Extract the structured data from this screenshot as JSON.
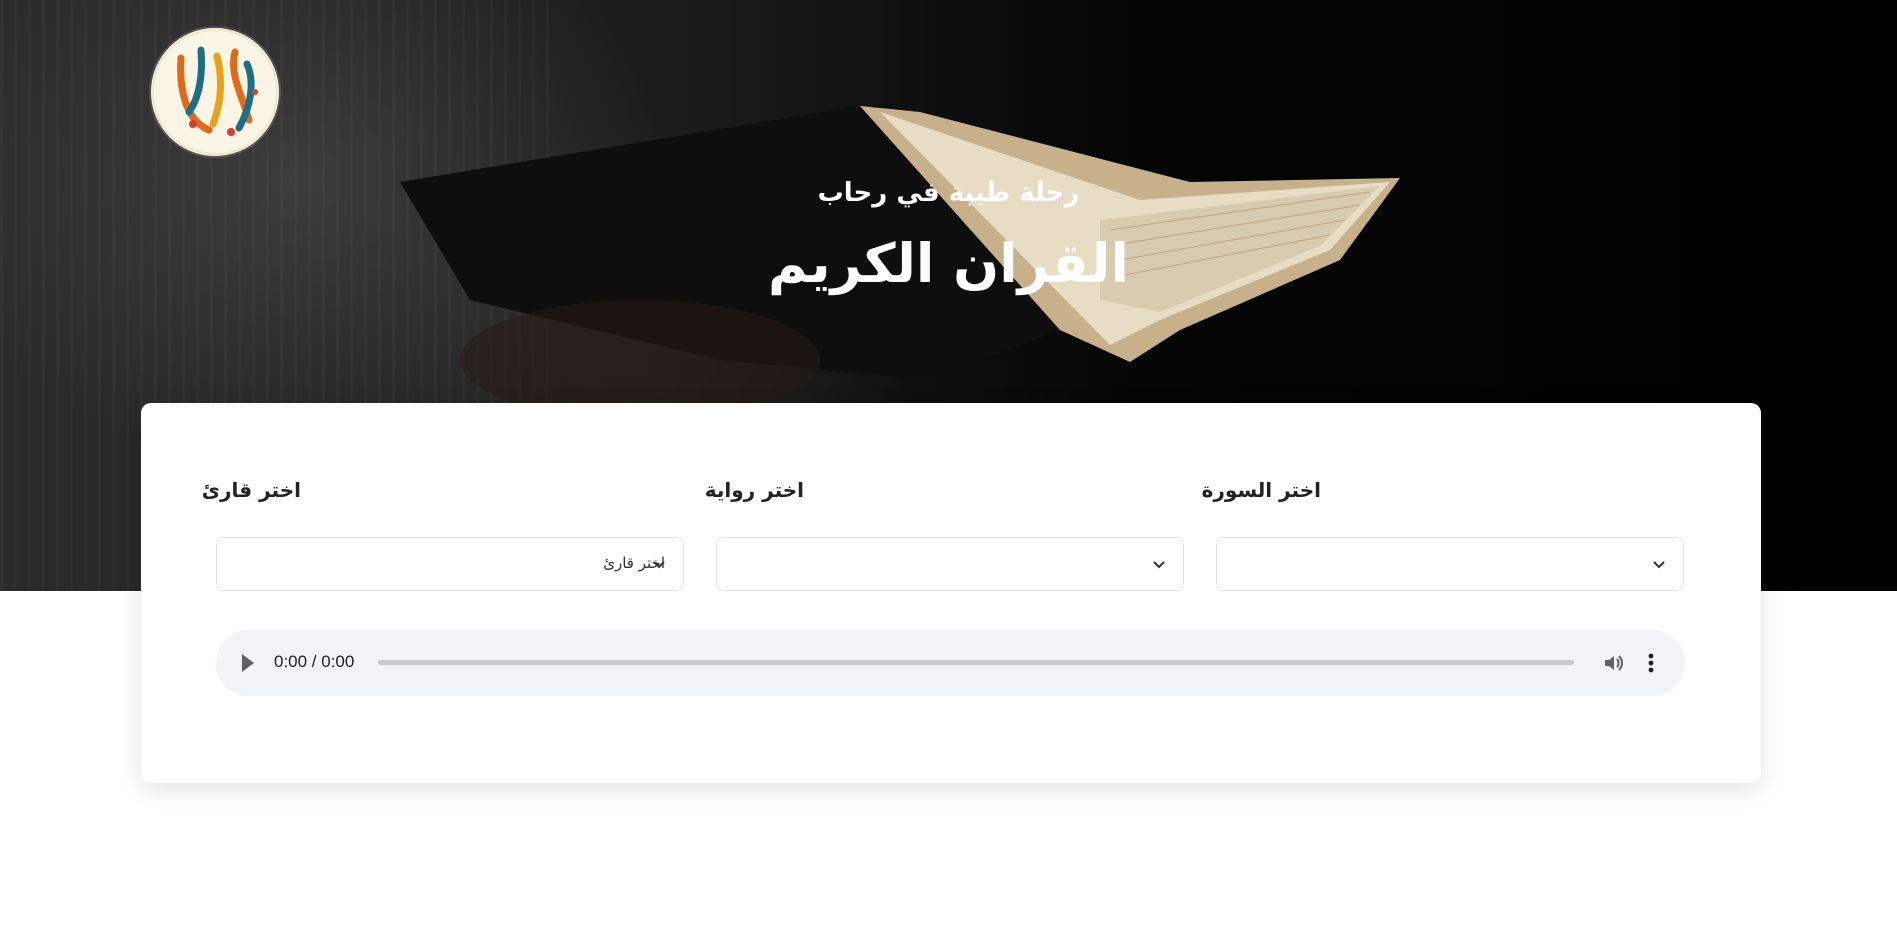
{
  "hero": {
    "subtitle": "رحلة طيبة في رحاب",
    "title": "القران الكريم"
  },
  "selectors": {
    "reciter": {
      "label": "اختر قارئ",
      "value": "اختر قارئ"
    },
    "riwaya": {
      "label": "اختر رواية",
      "value": ""
    },
    "surah": {
      "label": "اختر السورة",
      "value": ""
    }
  },
  "player": {
    "time": "0:00 / 0:00",
    "progress": 0
  },
  "icons": {
    "logo": "quran-calligraphy-logo",
    "chevron": "chevron-down-icon",
    "play": "play-icon",
    "volume": "volume-icon",
    "menu": "more-vert-icon"
  },
  "colors": {
    "hero_dark": "#000000",
    "card": "#ffffff",
    "player_bg": "#f1f3f4"
  }
}
